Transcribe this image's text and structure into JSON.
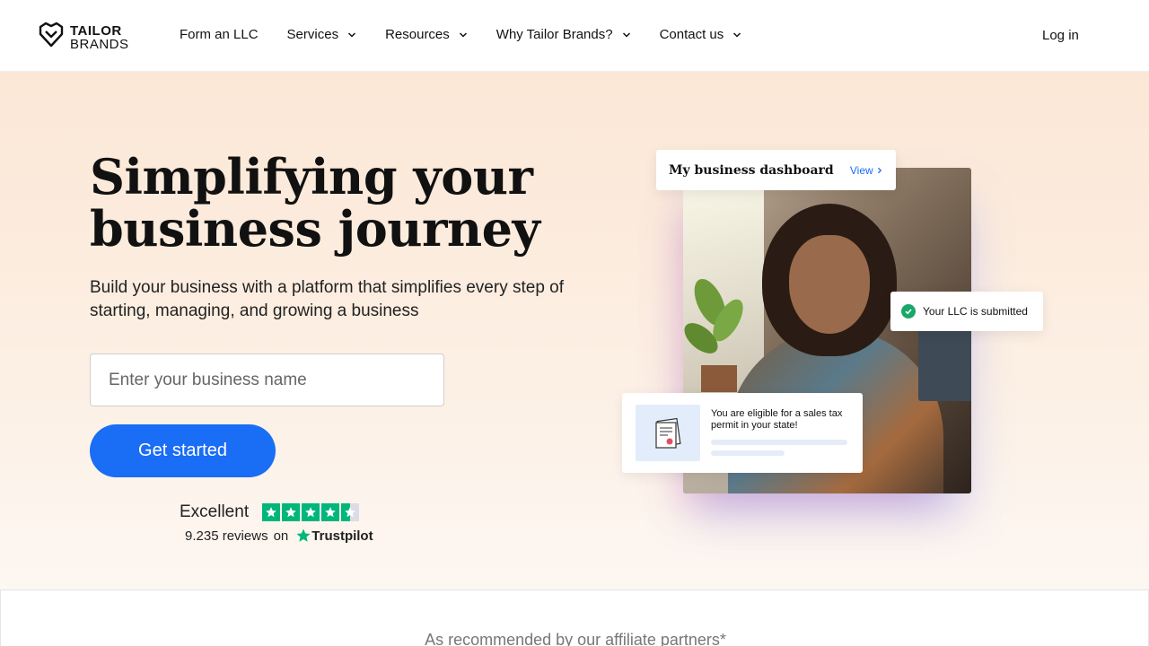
{
  "header": {
    "logo": {
      "line1": "TAILOR",
      "line2": "BRANDS"
    },
    "nav": [
      {
        "label": "Form an LLC",
        "dropdown": false
      },
      {
        "label": "Services",
        "dropdown": true
      },
      {
        "label": "Resources",
        "dropdown": true
      },
      {
        "label": "Why Tailor Brands?",
        "dropdown": true
      },
      {
        "label": "Contact us",
        "dropdown": true
      }
    ],
    "login_label": "Log in"
  },
  "hero": {
    "headline_line1": "Simplifying your",
    "headline_line2": "business journey",
    "subtitle": "Build your business with a platform that simplifies every step of starting, managing, and growing a business",
    "input": {
      "placeholder": "Enter your business name",
      "value": ""
    },
    "cta_label": "Get started",
    "trustpilot": {
      "rating_word": "Excellent",
      "rating_stars": 4.5,
      "max_stars": 5,
      "reviews_count": "9.235",
      "reviews_label": "reviews",
      "on_label": "on",
      "brand": "Trustpilot"
    }
  },
  "visual": {
    "dashboard_card": {
      "title": "My business dashboard",
      "link": "View"
    },
    "llc_card": {
      "text": "Your LLC is submitted"
    },
    "tax_card": {
      "text": "You are eligible for a sales tax permit in your state!"
    }
  },
  "partners": {
    "text": "As recommended by our affiliate partners*"
  },
  "colors": {
    "accent": "#1a6df5",
    "trustpilot_green": "#00b67a",
    "success": "#1aa86a"
  }
}
